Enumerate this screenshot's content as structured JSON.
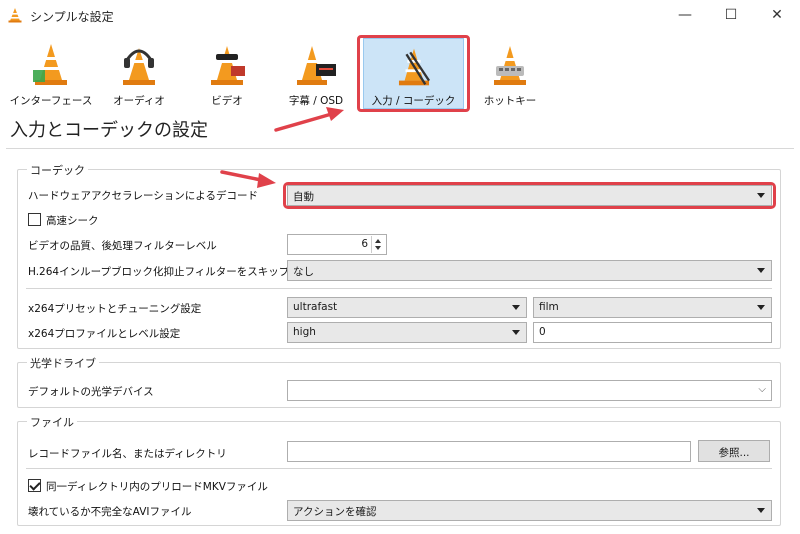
{
  "window": {
    "title": "シンプルな設定",
    "minimize_glyph": "—",
    "maximize_glyph": "☐",
    "close_glyph": "✕"
  },
  "categories": [
    {
      "label": "インターフェース",
      "icon": "interface-icon"
    },
    {
      "label": "オーディオ",
      "icon": "audio-icon"
    },
    {
      "label": "ビデオ",
      "icon": "video-icon"
    },
    {
      "label": "字幕 / OSD",
      "icon": "subtitles-icon"
    },
    {
      "label": "入力 / コーデック",
      "icon": "input-codecs-icon",
      "selected": true
    },
    {
      "label": "ホットキー",
      "icon": "hotkeys-icon"
    }
  ],
  "page_title": "入力とコーデックの設定",
  "codecs": {
    "group_title": "コーデック",
    "hw_decoding": {
      "label": "ハードウェアアクセラレーションによるデコード",
      "value": "自動"
    },
    "fast_seek": {
      "label": "高速シーク",
      "checked": false
    },
    "postproc": {
      "label": "ビデオの品質、後処理フィルターレベル",
      "value": "6"
    },
    "h264_skip": {
      "label": "H.264インループブロック化抑止フィルターをスキップ",
      "value": "なし"
    },
    "x264_preset": {
      "label": "x264プリセットとチューニング設定",
      "preset": "ultrafast",
      "tune": "film"
    },
    "x264_profile": {
      "label": "x264プロファイルとレベル設定",
      "profile": "high",
      "level": "0"
    }
  },
  "optical": {
    "group_title": "光学ドライブ",
    "default_device": {
      "label": "デフォルトの光学デバイス",
      "value": ""
    }
  },
  "files": {
    "group_title": "ファイル",
    "record_dir": {
      "label": "レコードファイル名、またはディレクトリ",
      "value": "",
      "browse_label": "参照..."
    },
    "preload_mkv": {
      "label": "同一ディレクトリ内のプリロードMKVファイル",
      "checked": true
    },
    "damaged_avi": {
      "label": "壊れているか不完全なAVIファイル",
      "value": "アクションを確認"
    }
  },
  "colors": {
    "highlight": "#e0414a",
    "selected_bg": "#cce4f7",
    "vlc_orange": "#f39a1f"
  }
}
